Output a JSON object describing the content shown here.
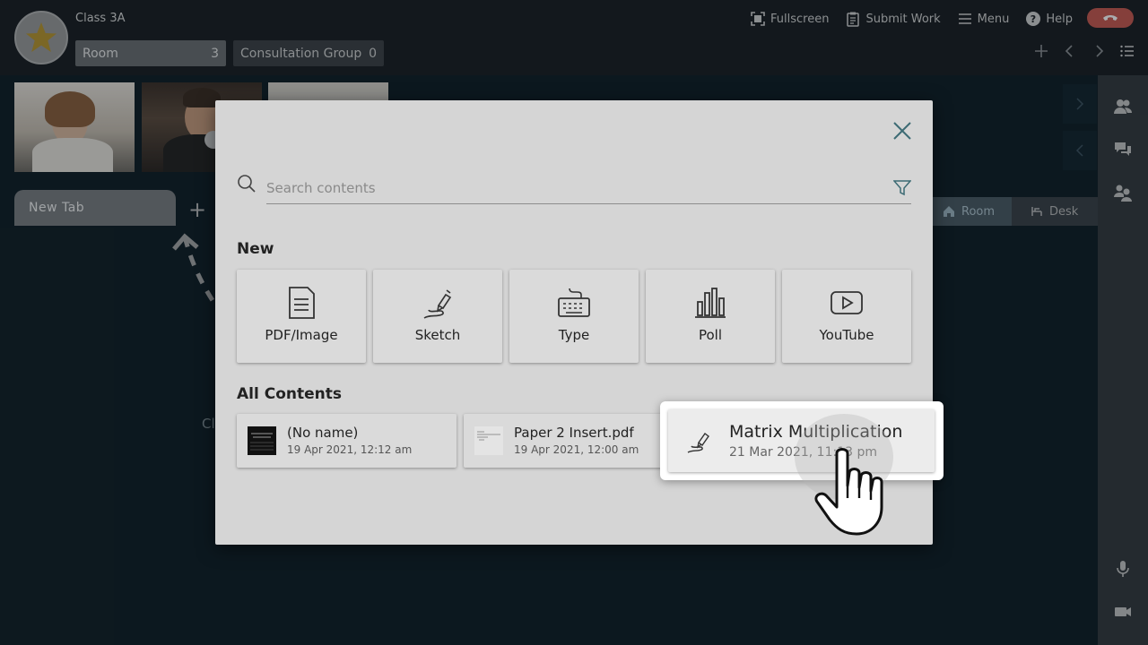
{
  "header": {
    "class_name": "Class 3A",
    "room_label": "Room",
    "room_count": "3",
    "consult_label": "Consultation Group",
    "consult_count": "0",
    "actions": {
      "fullscreen": "Fullscreen",
      "submit": "Submit Work",
      "menu": "Menu",
      "help": "Help"
    }
  },
  "stage": {
    "tab_label": "New Tab",
    "room_tab": "Room",
    "desk_tab": "Desk",
    "partial_text": "Cl"
  },
  "modal": {
    "search_placeholder": "Search contents",
    "new_title": "New",
    "new_items": [
      {
        "label": "PDF/Image",
        "icon": "document-icon"
      },
      {
        "label": "Sketch",
        "icon": "pen-icon"
      },
      {
        "label": "Type",
        "icon": "keyboard-icon"
      },
      {
        "label": "Poll",
        "icon": "bar-chart-icon"
      },
      {
        "label": "YouTube",
        "icon": "play-icon"
      }
    ],
    "all_title": "All Contents",
    "contents": [
      {
        "name": "(No name)",
        "date": "19 Apr 2021, 12:12 am"
      },
      {
        "name": "Paper 2 Insert.pdf",
        "date": "19 Apr 2021, 12:00 am"
      },
      {
        "name": "Matrix Multiplication",
        "date": "21 Mar 2021, 11:13 pm"
      }
    ]
  },
  "colors": {
    "accent_room": "#4a5a63",
    "hangup": "#c8584f",
    "star": "#b8952e"
  }
}
